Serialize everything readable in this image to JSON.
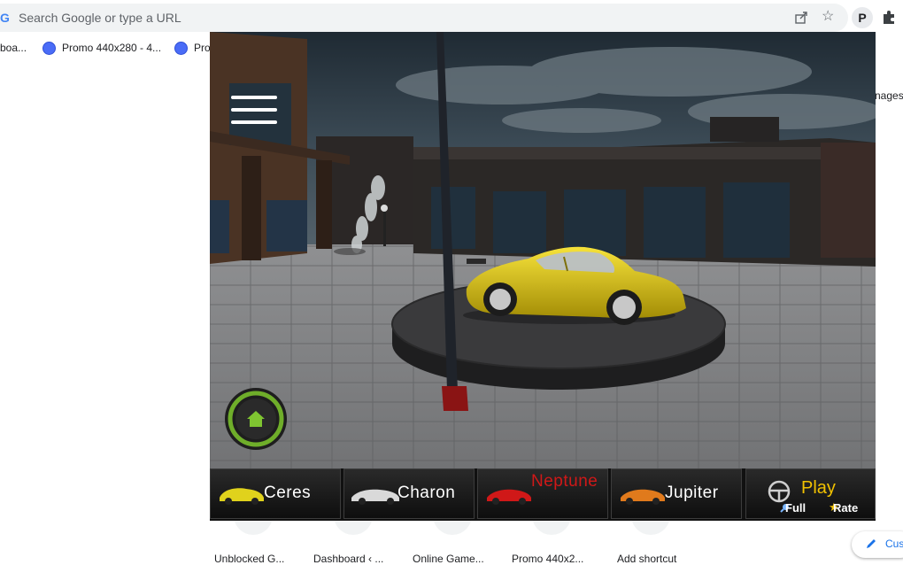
{
  "browser": {
    "omnibox_placeholder": "Search Google or type a URL",
    "profile_badge": "P"
  },
  "bookmarks": [
    {
      "label": "boa..."
    },
    {
      "label": "Promo 440x280 - 4..."
    },
    {
      "label": "Pro"
    }
  ],
  "sidebar_fragment": "nages",
  "shortcuts": [
    {
      "label": "Unblocked G..."
    },
    {
      "label": "Dashboard ‹ ..."
    },
    {
      "label": "Online Game..."
    },
    {
      "label": "Promo 440x2..."
    },
    {
      "label": "Add shortcut"
    }
  ],
  "customize_label": "Cus",
  "game": {
    "cars": [
      {
        "name": "Ceres",
        "color": "#e0d21c",
        "locked": false
      },
      {
        "name": "Charon",
        "color": "#d9d9d9",
        "locked": false
      },
      {
        "name": "Neptune",
        "color": "#d01818",
        "locked": true
      },
      {
        "name": "Jupiter",
        "color": "#e07a1c",
        "locked": false
      }
    ],
    "play_label": "Play",
    "full_label": "Full",
    "rate_label": "Rate",
    "showroom_car_color": "#e6cf12"
  }
}
